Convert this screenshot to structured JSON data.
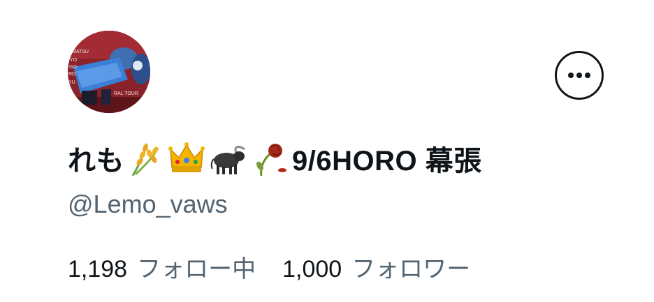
{
  "profile": {
    "display_name_prefix": "れも",
    "display_name_suffix": "9/6HORO 幕張",
    "name_emojis": [
      "rice-ear-icon",
      "crown-icon",
      "water-buffalo-icon",
      "wilted-rose-icon"
    ],
    "handle": "@Lemo_vaws",
    "avatar_text": [
      "MATSU",
      "YO",
      "GO",
      "RO",
      "KU",
      "RAL TOUR"
    ]
  },
  "stats": {
    "following_count": "1,198",
    "following_label": "フォロー中",
    "followers_count": "1,000",
    "followers_label": "フォロワー"
  },
  "colors": {
    "text_primary": "#0f1419",
    "text_secondary": "#536471",
    "background": "#ffffff"
  }
}
